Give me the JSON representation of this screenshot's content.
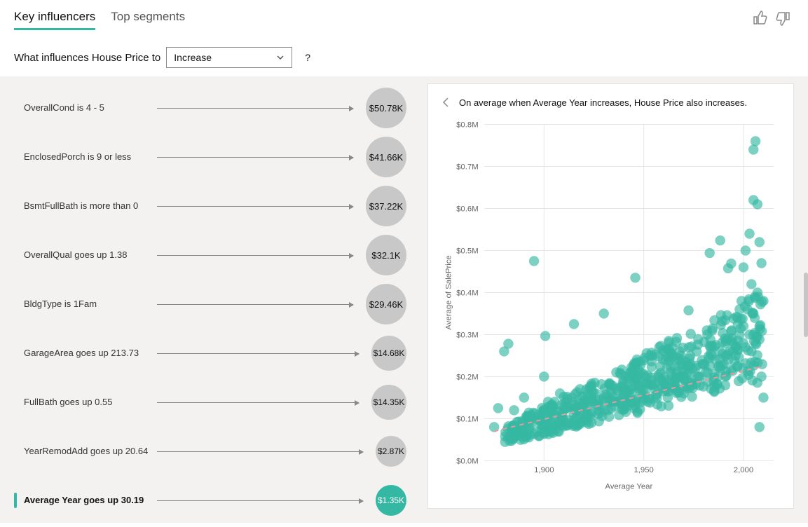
{
  "tabs": {
    "key_influencers": "Key influencers",
    "top_segments": "Top segments",
    "active": "key_influencers"
  },
  "question": {
    "prefix": "What influences House Price to",
    "select_value": "Increase",
    "help": "?"
  },
  "influencers": [
    {
      "label": "OverallCond is 4 - 5",
      "value": "$50.78K",
      "size": "big",
      "selected": false
    },
    {
      "label": "EnclosedPorch is 9 or less",
      "value": "$41.66K",
      "size": "big",
      "selected": false
    },
    {
      "label": "BsmtFullBath is more than 0",
      "value": "$37.22K",
      "size": "big",
      "selected": false
    },
    {
      "label": "OverallQual goes up 1.38",
      "value": "$32.1K",
      "size": "big",
      "selected": false
    },
    {
      "label": "BldgType is 1Fam",
      "value": "$29.46K",
      "size": "big",
      "selected": false
    },
    {
      "label": "GarageArea goes up 213.73",
      "value": "$14.68K",
      "size": "medium",
      "selected": false
    },
    {
      "label": "FullBath goes up 0.55",
      "value": "$14.35K",
      "size": "medium",
      "selected": false
    },
    {
      "label": "YearRemodAdd goes up 20.64",
      "value": "$2.87K",
      "size": "small",
      "selected": false
    },
    {
      "label": "Average Year goes up 30.19",
      "value": "$1.35K",
      "size": "small",
      "selected": true
    }
  ],
  "panel_title": "On average when Average Year increases, House Price also increases.",
  "chart_data": {
    "type": "scatter",
    "xlabel": "Average Year",
    "ylabel": "Average of SalePrice",
    "xlim": [
      1870,
      2015
    ],
    "ylim": [
      0,
      800000
    ],
    "x_ticks": [
      1900,
      1950,
      2000
    ],
    "y_ticks": [
      0,
      100000,
      200000,
      300000,
      400000,
      500000,
      600000,
      700000,
      800000
    ],
    "y_tick_labels": [
      "$0.0M",
      "$0.1M",
      "$0.2M",
      "$0.3M",
      "$0.4M",
      "$0.5M",
      "$0.6M",
      "$0.7M",
      "$0.8M"
    ],
    "trend": [
      [
        1875,
        70000
      ],
      [
        2010,
        225000
      ]
    ],
    "note": "dense cloud of points roughly increasing with year; points below are a representative sample read off the plot, not every pixel",
    "points": [
      [
        1875,
        80000
      ],
      [
        1877,
        125000
      ],
      [
        1880,
        260000
      ],
      [
        1885,
        120000
      ],
      [
        1890,
        150000
      ],
      [
        1892,
        100000
      ],
      [
        1895,
        475000
      ],
      [
        1898,
        95000
      ],
      [
        1900,
        120000
      ],
      [
        1900,
        200000
      ],
      [
        1902,
        140000
      ],
      [
        1905,
        110000
      ],
      [
        1908,
        160000
      ],
      [
        1910,
        130000
      ],
      [
        1912,
        90000
      ],
      [
        1914,
        150000
      ],
      [
        1915,
        325000
      ],
      [
        1916,
        120000
      ],
      [
        1918,
        170000
      ],
      [
        1920,
        135000
      ],
      [
        1922,
        110000
      ],
      [
        1924,
        145000
      ],
      [
        1926,
        160000
      ],
      [
        1928,
        130000
      ],
      [
        1930,
        150000
      ],
      [
        1930,
        350000
      ],
      [
        1932,
        120000
      ],
      [
        1934,
        160000
      ],
      [
        1936,
        140000
      ],
      [
        1938,
        175000
      ],
      [
        1940,
        150000
      ],
      [
        1942,
        130000
      ],
      [
        1944,
        160000
      ],
      [
        1946,
        145000
      ],
      [
        1948,
        175000
      ],
      [
        1950,
        160000
      ],
      [
        1952,
        140000
      ],
      [
        1954,
        180000
      ],
      [
        1956,
        155000
      ],
      [
        1958,
        170000
      ],
      [
        1960,
        165000
      ],
      [
        1962,
        150000
      ],
      [
        1964,
        190000
      ],
      [
        1966,
        175000
      ],
      [
        1968,
        200000
      ],
      [
        1970,
        160000
      ],
      [
        1972,
        210000
      ],
      [
        1974,
        185000
      ],
      [
        1976,
        220000
      ],
      [
        1978,
        200000
      ],
      [
        1980,
        230000
      ],
      [
        1982,
        210000
      ],
      [
        1984,
        250000
      ],
      [
        1985,
        190000
      ],
      [
        1986,
        240000
      ],
      [
        1988,
        260000
      ],
      [
        1990,
        230000
      ],
      [
        1991,
        200000
      ],
      [
        1992,
        290000
      ],
      [
        1993,
        260000
      ],
      [
        1994,
        310000
      ],
      [
        1995,
        280000
      ],
      [
        1996,
        250000
      ],
      [
        1997,
        340000
      ],
      [
        1998,
        300000
      ],
      [
        1999,
        380000
      ],
      [
        2000,
        320000
      ],
      [
        2000,
        460000
      ],
      [
        2001,
        270000
      ],
      [
        2001,
        500000
      ],
      [
        2002,
        360000
      ],
      [
        2003,
        300000
      ],
      [
        2003,
        540000
      ],
      [
        2004,
        260000
      ],
      [
        2004,
        420000
      ],
      [
        2005,
        620000
      ],
      [
        2005,
        740000
      ],
      [
        2005,
        350000
      ],
      [
        2006,
        280000
      ],
      [
        2006,
        760000
      ],
      [
        2007,
        400000
      ],
      [
        2007,
        610000
      ],
      [
        2008,
        320000
      ],
      [
        2008,
        520000
      ],
      [
        2008,
        80000
      ],
      [
        2009,
        200000
      ],
      [
        2009,
        470000
      ],
      [
        2010,
        150000
      ],
      [
        2010,
        380000
      ]
    ]
  }
}
